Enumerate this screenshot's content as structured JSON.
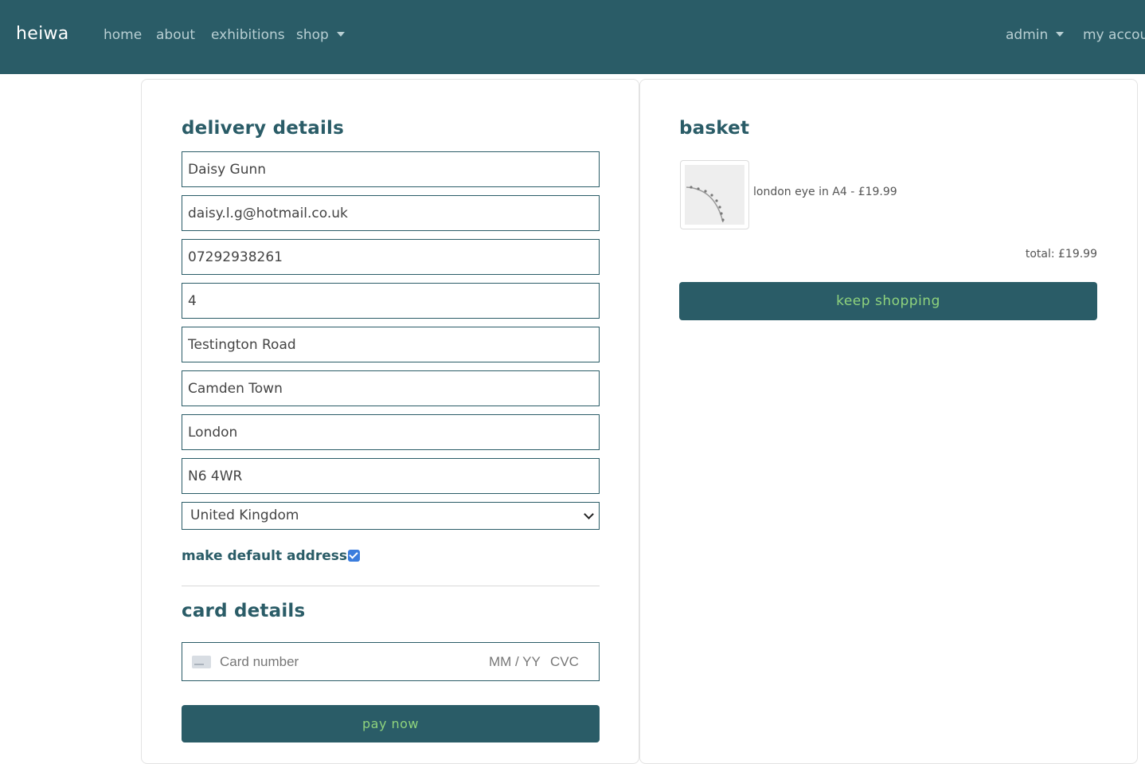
{
  "nav": {
    "brand": "heiwa",
    "links": [
      "home",
      "about",
      "exhibitions",
      "shop"
    ],
    "admin": "admin",
    "account": "my account"
  },
  "delivery": {
    "title": "delivery details",
    "full_name": "Daisy Gunn",
    "email": "daisy.l.g@hotmail.co.uk",
    "phone": "07292938261",
    "street_address1": "4",
    "street_address2": "Testington Road",
    "town_or_city": "Camden Town",
    "county": "London",
    "postcode": "N6 4WR",
    "country": "United Kingdom",
    "default_label": "make default address:",
    "default_checked": true
  },
  "card": {
    "title": "card details",
    "number_placeholder": "Card number",
    "exp_placeholder": "MM / YY",
    "cvc_placeholder": "CVC",
    "pay_label": "pay now"
  },
  "basket": {
    "title": "basket",
    "items": [
      {
        "label": "london eye in A4 - £19.99"
      }
    ],
    "total": "total: £19.99",
    "keep_shopping_label": "keep shopping"
  },
  "colors": {
    "primary": "#2a5c67",
    "button_text": "#8fd37d",
    "checkbox": "#3b7ddd"
  }
}
